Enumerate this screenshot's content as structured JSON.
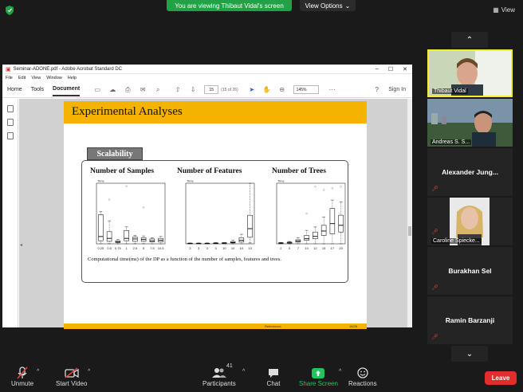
{
  "banner": {
    "sharing_text": "You are viewing Thibaut Vidal's screen",
    "view_options": "View Options",
    "view_label": "View"
  },
  "acrobat": {
    "title": "Seminar-ADONE.pdf - Adobe Acrobat Standard DC",
    "menu": [
      "File",
      "Edit",
      "View",
      "Window",
      "Help"
    ],
    "tabs": [
      "Home",
      "Tools",
      "Document"
    ],
    "page_current": "15",
    "page_total": "(15 of 26)",
    "zoom": "145%",
    "sign_in": "Sign In"
  },
  "slide": {
    "title": "Experimental Analyses",
    "section_label": "Scalability",
    "caption": "Computational time(ms) of the DP as a function of the number of samples, features and trees.",
    "footer_ref": "References",
    "footer_page": "16/26"
  },
  "chart_data": [
    {
      "type": "box",
      "title": "Number of Samples",
      "ylabel": "Time",
      "categories": [
        "0.25",
        "0.5",
        "0.75",
        "1",
        "2.5",
        "5",
        "7.5",
        "10.5"
      ],
      "boxes": [
        {
          "min": 0,
          "q1": 5,
          "median": 12,
          "q3": 48,
          "max": 53
        },
        {
          "min": 0,
          "q1": 4,
          "median": 9,
          "q3": 20,
          "max": 38
        },
        {
          "min": 0,
          "q1": 2,
          "median": 3,
          "q3": 5,
          "max": 7
        },
        {
          "min": 0,
          "q1": 5,
          "median": 9,
          "q3": 22,
          "max": 28
        },
        {
          "min": 0,
          "q1": 4,
          "median": 8,
          "q3": 11,
          "max": 14
        },
        {
          "min": 0,
          "q1": 4,
          "median": 7,
          "q3": 10,
          "max": 13
        },
        {
          "min": 0,
          "q1": 3,
          "median": 5,
          "q3": 8,
          "max": 10
        },
        {
          "min": 0,
          "q1": 3,
          "median": 6,
          "q3": 9,
          "max": 12
        }
      ],
      "outliers": [
        [
          1,
          73
        ],
        [
          3,
          95
        ],
        [
          5,
          60
        ]
      ],
      "ylim": [
        0,
        100
      ]
    },
    {
      "type": "box",
      "title": "Number of Features",
      "ylabel": "Time",
      "categories": [
        "3",
        "3",
        "3",
        "3",
        "10",
        "10",
        "10",
        "13"
      ],
      "boxes": [
        {
          "min": 0,
          "q1": 0.5,
          "median": 1,
          "q3": 1.5,
          "max": 2
        },
        {
          "min": 0,
          "q1": 0.5,
          "median": 1,
          "q3": 1.5,
          "max": 2
        },
        {
          "min": 0,
          "q1": 0.5,
          "median": 1,
          "q3": 1.5,
          "max": 2
        },
        {
          "min": 0,
          "q1": 0.5,
          "median": 1,
          "q3": 2,
          "max": 3
        },
        {
          "min": 0,
          "q1": 1,
          "median": 1.5,
          "q3": 2.5,
          "max": 3
        },
        {
          "min": 0,
          "q1": 2,
          "median": 3,
          "q3": 5,
          "max": 8
        },
        {
          "min": 0,
          "q1": 4,
          "median": 8,
          "q3": 14,
          "max": 22
        },
        {
          "min": 2,
          "q1": 15,
          "median": 35,
          "q3": 66,
          "max": 140
        }
      ],
      "outliers": [],
      "ylim": [
        0,
        140
      ]
    },
    {
      "type": "box",
      "title": "Number of Trees",
      "ylabel": "Time",
      "categories": [
        "2",
        "5",
        "7",
        "10",
        "12",
        "15",
        "17",
        "20"
      ],
      "boxes": [
        {
          "min": 0,
          "q1": 1,
          "median": 2,
          "q3": 3,
          "max": 4
        },
        {
          "min": 0,
          "q1": 2,
          "median": 3,
          "q3": 5,
          "max": 7
        },
        {
          "min": 0,
          "q1": 5,
          "median": 8,
          "q3": 12,
          "max": 18
        },
        {
          "min": 0,
          "q1": 10,
          "median": 15,
          "q3": 25,
          "max": 40
        },
        {
          "min": 0,
          "q1": 15,
          "median": 22,
          "q3": 35,
          "max": 50
        },
        {
          "min": 0,
          "q1": 25,
          "median": 38,
          "q3": 55,
          "max": 80
        },
        {
          "min": 0,
          "q1": 30,
          "median": 60,
          "q3": 105,
          "max": 130
        },
        {
          "min": 0,
          "q1": 35,
          "median": 55,
          "q3": 85,
          "max": 125
        }
      ],
      "outliers": [
        [
          3,
          90
        ],
        [
          4,
          170
        ],
        [
          5,
          160
        ],
        [
          6,
          165
        ],
        [
          7,
          170
        ]
      ],
      "ylim": [
        0,
        180
      ]
    }
  ],
  "participants": [
    {
      "name": "Thibaut Vidal",
      "video": true,
      "muted": false,
      "active": true
    },
    {
      "name": "Andreas S. S...",
      "video": true,
      "muted": false,
      "active": false
    },
    {
      "name": "Alexander  Jung...",
      "video": false,
      "muted": true,
      "active": false
    },
    {
      "name": "Caroline Spiecke...",
      "video": true,
      "muted": true,
      "active": false
    },
    {
      "name": "Burakhan Sel",
      "video": false,
      "muted": true,
      "active": false
    },
    {
      "name": "Ramin Barzanji",
      "video": false,
      "muted": true,
      "active": false
    }
  ],
  "bottombar": {
    "unmute": "Unmute",
    "start_video": "Start Video",
    "participants": "Participants",
    "participants_count": "41",
    "chat": "Chat",
    "share_screen": "Share Screen",
    "reactions": "Reactions",
    "leave": "Leave"
  },
  "colors": {
    "accent_green": "#23a146",
    "slide_banner": "#f5b301",
    "leave_red": "#e02e2a",
    "active_speaker": "#f3ef2f"
  }
}
